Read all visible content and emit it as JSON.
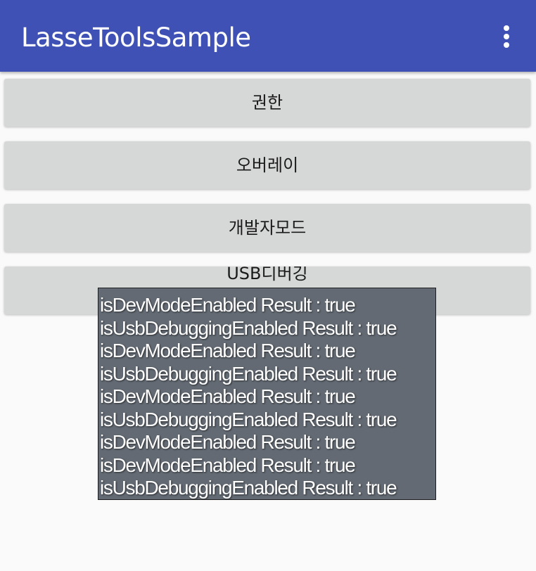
{
  "app_bar": {
    "title": "LasseToolsSample",
    "background": "#3f51b5",
    "overflow_icon": "more-vert-icon"
  },
  "buttons": [
    {
      "label": "권한"
    },
    {
      "label": "오버레이"
    },
    {
      "label": "개발자모드"
    },
    {
      "label": "USB디버깅"
    }
  ],
  "toast": {
    "lines": [
      "isDevModeEnabled Result : true",
      "isUsbDebuggingEnabled Result : true",
      "isDevModeEnabled Result : true",
      "isUsbDebuggingEnabled Result : true",
      "isDevModeEnabled Result : true",
      "isUsbDebuggingEnabled Result : true",
      "isDevModeEnabled Result : true",
      "isDevModeEnabled Result : true",
      "isUsbDebuggingEnabled Result : true"
    ]
  }
}
